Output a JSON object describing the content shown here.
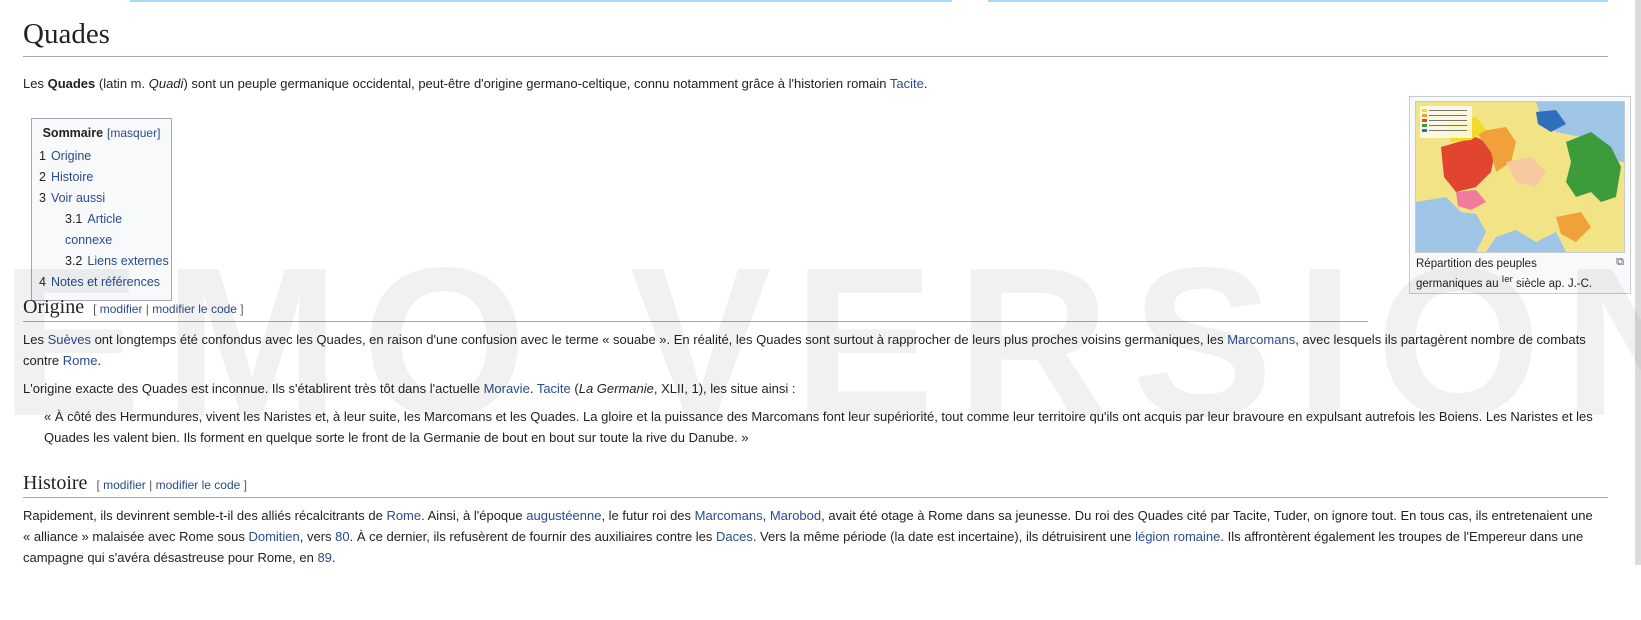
{
  "article": {
    "title": "Quades",
    "intro": {
      "t1": "Les ",
      "b1": "Quades",
      "t2": " (latin m. ",
      "i1": "Quadi",
      "t3": ") sont un peuple germanique occidental, peut-être d'origine germano-celtique, connu notamment grâce à l'historien romain ",
      "l1": "Tacite",
      "t4": "."
    }
  },
  "toc": {
    "title": "Sommaire",
    "toggle": "[masquer]",
    "items": [
      {
        "num": "1",
        "label": "Origine"
      },
      {
        "num": "2",
        "label": "Histoire"
      },
      {
        "num": "3",
        "label": "Voir aussi"
      },
      {
        "num": "3.1",
        "label": "Article connexe"
      },
      {
        "num": "3.2",
        "label": "Liens externes"
      },
      {
        "num": "4",
        "label": "Notes et références"
      }
    ]
  },
  "thumb": {
    "caption1": "Répartition des peuples",
    "caption2a": "germaniques au ",
    "caption2sup": "Ier",
    "caption2b": " siècle ap. J.-C."
  },
  "watermark": "EMO VERSION",
  "edit": {
    "open": "[ ",
    "modifier": "modifier",
    "sep": " | ",
    "code": "modifier le code",
    "close": " ]"
  },
  "origine": {
    "heading": "Origine",
    "p1": {
      "t1": "Les ",
      "l1": "Suèves",
      "t2": " ont longtemps été confondus avec les Quades, en raison d'une confusion avec le terme « souabe ». En réalité, les Quades sont surtout à rapprocher de leurs plus proches voisins germaniques, les ",
      "l2": "Marcomans",
      "t3": ", avec lesquels ils partagèrent nombre de combats contre ",
      "l3": "Rome",
      "t4": "."
    },
    "p2": {
      "t1": "L'origine exacte des Quades est inconnue. Ils s'établirent très tôt dans l'actuelle ",
      "l1": "Moravie",
      "t2": ". ",
      "l2": "Tacite",
      "t3": " (",
      "i1": "La Germanie",
      "t4": ", XLII, 1), les situe ainsi :"
    },
    "quote": "« À côté des Hermundures, vivent les Naristes et, à leur suite, les Marcomans et les Quades. La gloire et la puissance des Marcomans font leur supériorité, tout comme leur territoire qu'ils ont acquis par leur bravoure en expulsant autrefois les Boiens. Les Naristes et les Quades les valent bien. Ils forment en quelque sorte le front de la Germanie de bout en bout sur toute la rive du Danube. »"
  },
  "histoire": {
    "heading": "Histoire",
    "p1": {
      "t1": "Rapidement, ils devinrent semble-t-il des alliés récalcitrants de ",
      "l1": "Rome",
      "t2": ". Ainsi, à l'époque ",
      "l2": "augustéenne",
      "t3": ", le futur roi des ",
      "l3": "Marcomans",
      "t4": ", ",
      "l4": "Marobod",
      "t5": ", avait été otage à Rome dans sa jeunesse. Du roi des Quades cité par Tacite, Tuder, on ignore tout. En tous cas, ils entretenaient une « alliance » malaisée avec Rome sous ",
      "l5": "Domitien",
      "t6": ", vers ",
      "l6": "80",
      "t7": ". À ce dernier, ils refusèrent de fournir des auxiliaires contre les ",
      "l7": "Daces",
      "t8": ". Vers la même période (la date est incertaine), ils détruisirent une ",
      "l8": "légion romaine",
      "t9": ". Ils affrontèrent également les troupes de l'Empereur dans une campagne qui s'avéra désastreuse pour Rome, en ",
      "l9": "89",
      "t10": "."
    }
  },
  "colors": {
    "link": "#2a4b8d",
    "text": "#222222",
    "border": "#a2a9b1",
    "toc_bg": "#f8f9fa",
    "top_bar": "#a7d7f9"
  }
}
